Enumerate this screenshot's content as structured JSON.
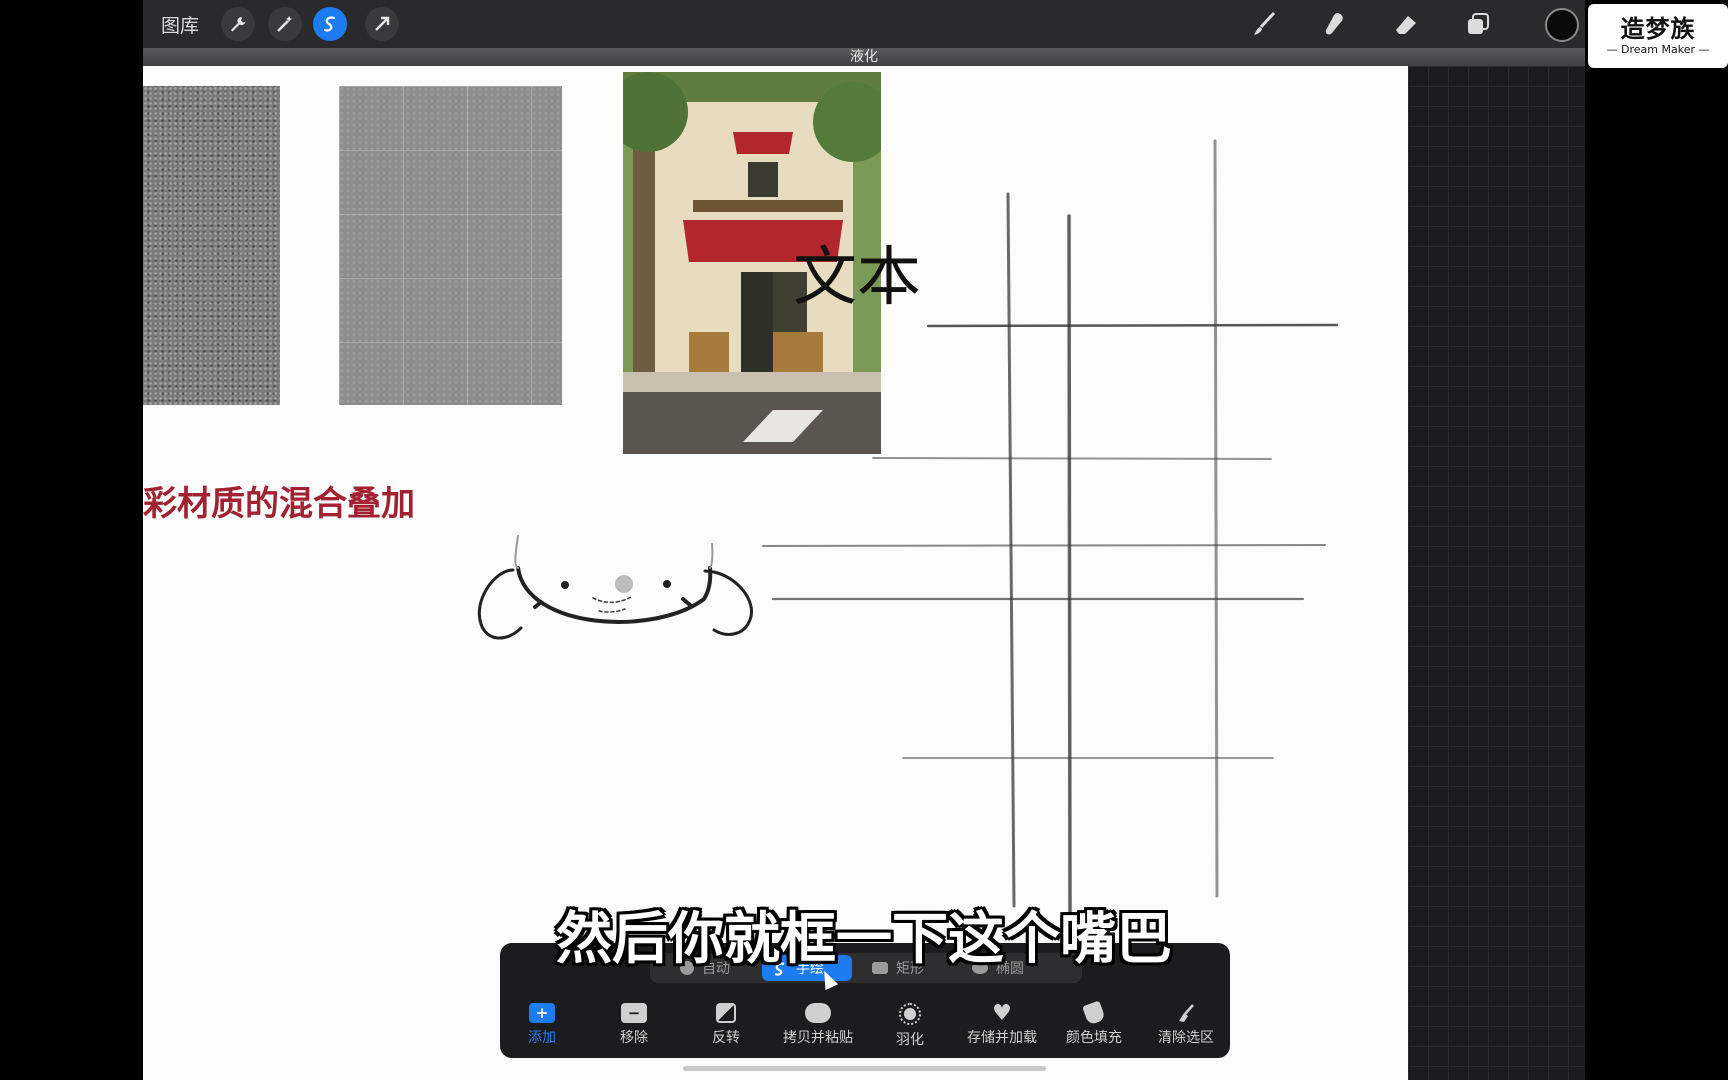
{
  "toolbar": {
    "gallery_label": "图库",
    "left_icons": [
      "wrench-icon",
      "magic-wand-icon",
      "selection-icon",
      "transform-arrow-icon"
    ],
    "right_icons": [
      "brush-icon",
      "smudge-icon",
      "eraser-icon",
      "layers-icon"
    ],
    "color": "#0a0a0a"
  },
  "title_strip": {
    "label": "液化"
  },
  "logo": {
    "cn": "造梦族",
    "en": "— Dream Maker —"
  },
  "canvas": {
    "overlay_text": "文本",
    "red_heading": "彩材质的混合叠加"
  },
  "selection_bar": {
    "modes": [
      {
        "label": "自动",
        "icon": "auto-select-icon"
      },
      {
        "label": "手绘",
        "icon": "freehand-icon"
      },
      {
        "label": "矩形",
        "icon": "rectangle-icon"
      },
      {
        "label": "椭圆",
        "icon": "ellipse-icon"
      }
    ],
    "active_mode": "手绘",
    "actions": [
      {
        "label": "添加",
        "icon": "add-icon"
      },
      {
        "label": "移除",
        "icon": "remove-icon"
      },
      {
        "label": "反转",
        "icon": "invert-icon"
      },
      {
        "label": "拷贝并粘贴",
        "icon": "copy-paste-icon"
      },
      {
        "label": "羽化",
        "icon": "feather-icon"
      },
      {
        "label": "存储并加载",
        "icon": "heart-icon"
      },
      {
        "label": "颜色填充",
        "icon": "fill-icon"
      },
      {
        "label": "清除选区",
        "icon": "clear-icon"
      }
    ]
  },
  "subtitle": "然后你就框一下这个嘴巴",
  "colors": {
    "accent": "#1e7cf2",
    "heading_red": "#a32231"
  }
}
